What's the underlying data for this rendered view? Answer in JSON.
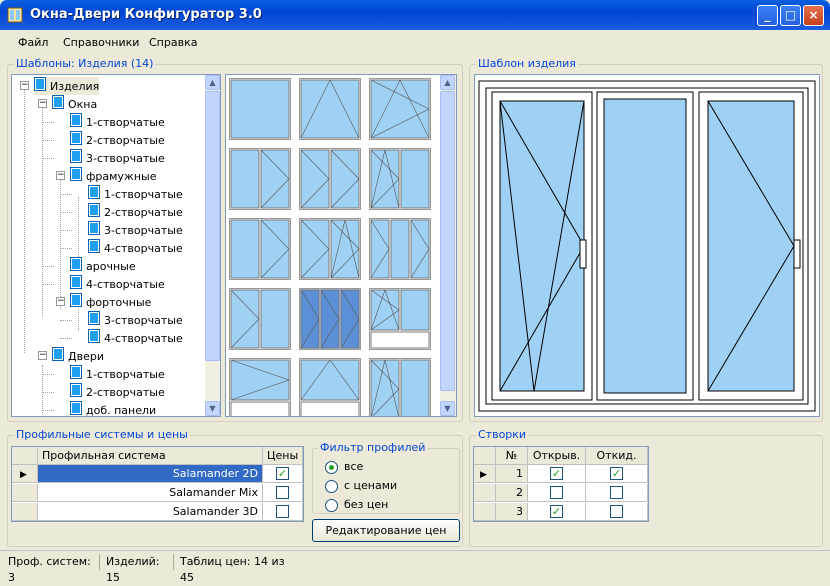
{
  "window": {
    "title": "Окна-Двери Конфигуратор 3.0",
    "controls": [
      "minimize-icon",
      "maximize-icon",
      "close-icon"
    ]
  },
  "menu": [
    "Файл",
    "Справочники",
    "Справка"
  ],
  "templates_group": {
    "label": "Шаблоны: Изделия (14)"
  },
  "tree": [
    {
      "label": "Изделия",
      "level": 0
    },
    {
      "label": "Окна",
      "level": 1
    },
    {
      "label": "1-створчатые",
      "level": 2
    },
    {
      "label": "2-створчатые",
      "level": 2
    },
    {
      "label": "3-створчатые",
      "level": 2
    },
    {
      "label": "фрамужные",
      "level": 2
    },
    {
      "label": "1-створчатые",
      "level": 3
    },
    {
      "label": "2-створчатые",
      "level": 3
    },
    {
      "label": "3-створчатые",
      "level": 3
    },
    {
      "label": "4-створчатые",
      "level": 3
    },
    {
      "label": "арочные",
      "level": 2
    },
    {
      "label": "4-створчатые",
      "level": 2
    },
    {
      "label": "форточные",
      "level": 2
    },
    {
      "label": "3-створчатые",
      "level": 3
    },
    {
      "label": "4-створчатые",
      "level": 3
    },
    {
      "label": "Двери",
      "level": 1
    },
    {
      "label": "1-створчатые",
      "level": 2
    },
    {
      "label": "2-створчатые",
      "level": 2
    },
    {
      "label": "доб. панели",
      "level": 2
    }
  ],
  "template_preview_group": {
    "label": "Шаблон изделия"
  },
  "profiles_group": {
    "label": "Профильные системы и цены",
    "columns": [
      "Профильная система",
      "Цены"
    ],
    "rows": [
      {
        "name": "Salamander 2D",
        "prices": true,
        "selected": true
      },
      {
        "name": "Salamander Mix",
        "prices": false,
        "selected": false
      },
      {
        "name": "Salamander 3D",
        "prices": false,
        "selected": false
      }
    ]
  },
  "filter_group": {
    "label": "Фильтр профилей",
    "options": [
      {
        "label": "все",
        "checked": true
      },
      {
        "label": "с ценами",
        "checked": false
      },
      {
        "label": "без цен",
        "checked": false
      }
    ],
    "edit_button": "Редактирование цен"
  },
  "sashes_group": {
    "label": "Створки",
    "columns": [
      "№",
      "Открыв.",
      "Откид."
    ],
    "rows": [
      {
        "n": "1",
        "open": true,
        "tilt": true
      },
      {
        "n": "2",
        "open": false,
        "tilt": false
      },
      {
        "n": "3",
        "open": true,
        "tilt": false
      }
    ]
  },
  "status": [
    "Проф. систем: 3",
    "Изделий: 15",
    "Таблиц цен: 14 из 45"
  ],
  "colors": {
    "title_blue": "#0046d5",
    "glass": "#9fd1f5",
    "selection": "#316ac5"
  }
}
